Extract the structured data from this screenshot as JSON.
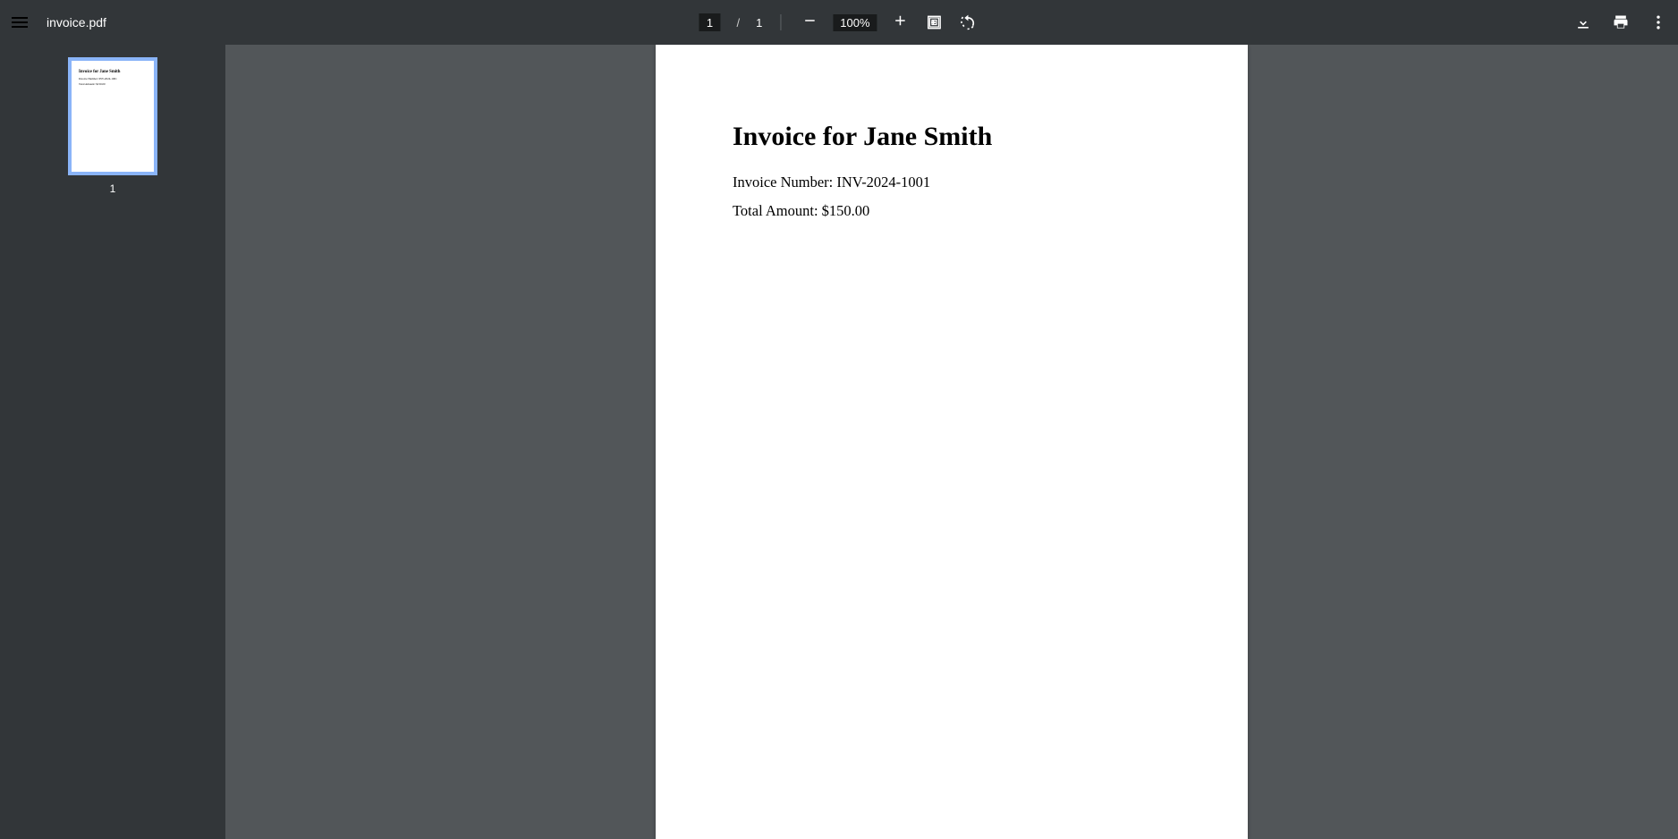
{
  "toolbar": {
    "filename": "invoice.pdf",
    "current_page": "1",
    "page_separator": "/",
    "total_pages": "1",
    "zoom_level": "100%"
  },
  "sidebar": {
    "thumbnails": [
      {
        "label": "1"
      }
    ]
  },
  "document": {
    "heading": "Invoice for Jane Smith",
    "lines": [
      "Invoice Number: INV-2024-1001",
      "Total Amount: $150.00"
    ]
  }
}
